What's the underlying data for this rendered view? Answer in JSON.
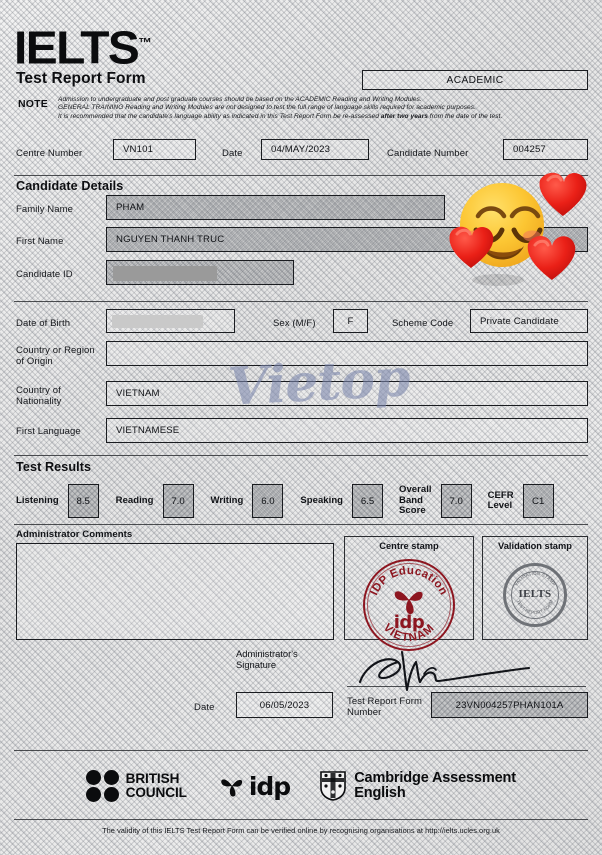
{
  "document": {
    "logo": "IELTS",
    "logo_tm": "™",
    "title": "Test Report Form",
    "module": "ACADEMIC",
    "note_label": "NOTE",
    "note_lines": [
      "Admission to undergraduate and post graduate courses should be based on the ACADEMIC Reading and Writing Modules.",
      "GENERAL TRAINING Reading and Writing Modules are not designed to test the full range of language skills required for academic purposes.",
      "It is recommended that the candidate's language ability as indicated in this Test Report Form be re-assessed after two years from the date of the test."
    ],
    "note_bold_phrase": "after two years"
  },
  "header_fields": {
    "centre_number_label": "Centre Number",
    "centre_number_value": "VN101",
    "date_label": "Date",
    "date_value": "04/MAY/2023",
    "candidate_number_label": "Candidate Number",
    "candidate_number_value": "004257"
  },
  "candidate_details": {
    "section_title": "Candidate Details",
    "family_name_label": "Family Name",
    "family_name_value": "PHAM",
    "first_name_label": "First Name",
    "first_name_value": "NGUYEN THANH TRUC",
    "candidate_id_label": "Candidate ID",
    "candidate_id_value": "",
    "date_of_birth_label": "Date of Birth",
    "date_of_birth_value": "",
    "sex_label": "Sex (M/F)",
    "sex_value": "F",
    "scheme_code_label": "Scheme Code",
    "scheme_code_value": "Private Candidate",
    "country_origin_label": "Country or Region\nof Origin",
    "country_origin_value": "",
    "country_nationality_label": "Country of\nNationality",
    "country_nationality_value": "VIETNAM",
    "first_language_label": "First Language",
    "first_language_value": "VIETNAMESE"
  },
  "test_results": {
    "section_title": "Test Results",
    "scores": [
      {
        "label": "Listening",
        "value": "8.5"
      },
      {
        "label": "Reading",
        "value": "7.0"
      },
      {
        "label": "Writing",
        "value": "6.0"
      },
      {
        "label": "Speaking",
        "value": "6.5"
      },
      {
        "label": "Overall\nBand\nScore",
        "value": "7.0"
      },
      {
        "label": "CEFR\nLevel",
        "value": "C1"
      }
    ]
  },
  "administration": {
    "comments_label": "Administrator Comments",
    "comments_value": "",
    "centre_stamp_label": "Centre stamp",
    "centre_stamp_top_text": "IDP Education",
    "centre_stamp_middle_text": "idp",
    "centre_stamp_bottom_text": "VIETNAM",
    "validation_stamp_label": "Validation stamp",
    "validation_stamp_text": "IELTS",
    "signature_label": "Administrator's\nSignature",
    "date_label": "Date",
    "date_value": "06/05/2023",
    "trf_number_label": "Test Report Form\nNumber",
    "trf_number_value": "23VN004257PHAN101A"
  },
  "footer": {
    "british_council": "BRITISH\nCOUNCIL",
    "idp": "idp",
    "cambridge": "Cambridge Assessment\nEnglish",
    "validity": "The validity of this IELTS Test Report Form can be verified online by recognising organisations at http://ielts.ucles.org.uk"
  },
  "overlays": {
    "watermark": "Vietop",
    "emoji": "smiling-face-with-hearts"
  },
  "colors": {
    "stamp_red": "#8d1620",
    "watermark_blue": "#7c87ad",
    "ink": "#0b0c0e",
    "emoji_yellow": "#fbc02d",
    "heart_red": "#e32119"
  }
}
